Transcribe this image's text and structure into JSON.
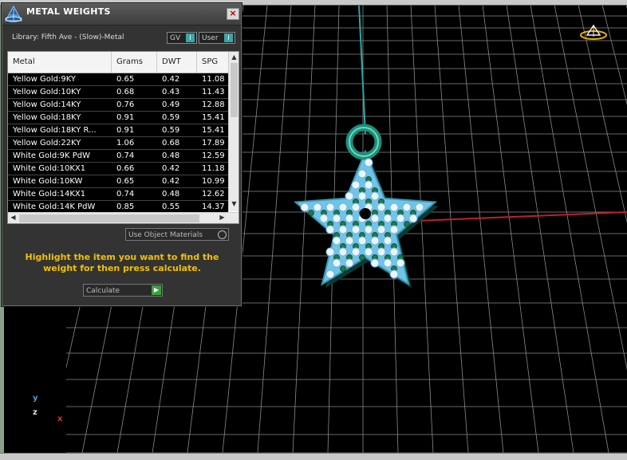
{
  "dialog": {
    "title": "METAL WEIGHTS",
    "close_symbol": "×",
    "library_label": "Library: Fifth Ave - (Slow)-Metal",
    "toggles": [
      {
        "label": "GV",
        "state": "I"
      },
      {
        "label": "User",
        "state": "I"
      }
    ],
    "use_object_materials": "Use Object Materials",
    "instruction": "Highlight the item you want to find the weight for then press calculate.",
    "calculate_label": "Calculate",
    "calculate_icon": "▶"
  },
  "table": {
    "columns": [
      "Metal",
      "Grams",
      "DWT",
      "SPG"
    ],
    "rows": [
      [
        "Yellow Gold:9KY",
        "0.65",
        "0.42",
        "11.08"
      ],
      [
        "Yellow Gold:10KY",
        "0.68",
        "0.43",
        "11.43"
      ],
      [
        "Yellow Gold:14KY",
        "0.76",
        "0.49",
        "12.88"
      ],
      [
        "Yellow Gold:18KY",
        "0.91",
        "0.59",
        "15.41"
      ],
      [
        "Yellow Gold:18KY R...",
        "0.91",
        "0.59",
        "15.41"
      ],
      [
        "Yellow Gold:22KY",
        "1.06",
        "0.68",
        "17.89"
      ],
      [
        "White Gold:9K PdW",
        "0.74",
        "0.48",
        "12.59"
      ],
      [
        "White Gold:10KX1",
        "0.66",
        "0.42",
        "11.18"
      ],
      [
        "White Gold:10KW",
        "0.65",
        "0.42",
        "10.99"
      ],
      [
        "White Gold:14KX1",
        "0.74",
        "0.48",
        "12.62"
      ],
      [
        "White Gold:14K PdW",
        "0.85",
        "0.55",
        "14.37"
      ]
    ]
  },
  "viewport": {
    "axis_y": "y",
    "axis_z": "z",
    "axis_x": "x",
    "colors": {
      "grid": "#8a8a8a",
      "x_axis": "#c0202a",
      "z_axis": "#2aa8a8",
      "star_fill": "#6fc4e8",
      "bead": "#1f7a4a"
    }
  }
}
